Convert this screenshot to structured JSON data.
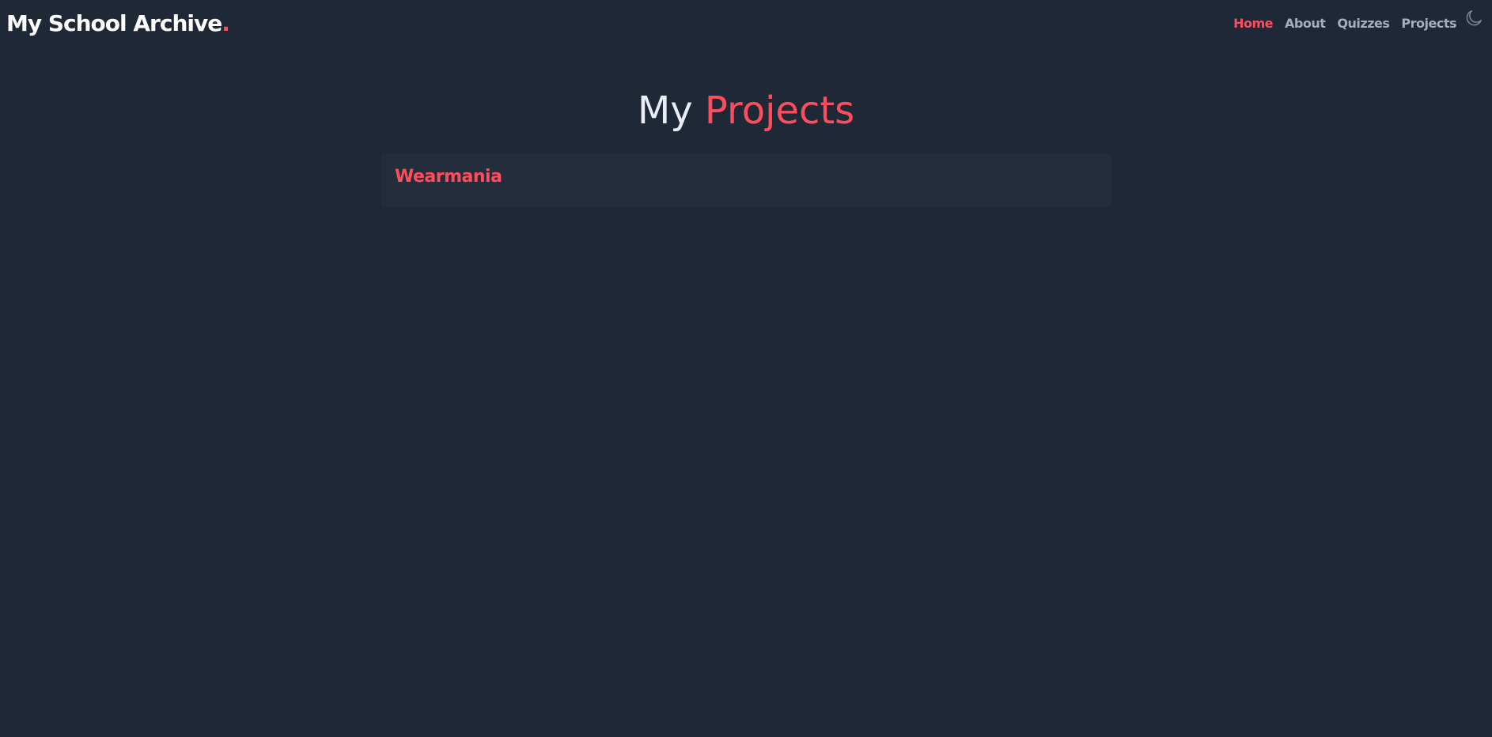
{
  "brand": {
    "name": "My School Archive",
    "dot": "."
  },
  "nav": {
    "items": [
      {
        "label": "Home",
        "active": true
      },
      {
        "label": "About",
        "active": false
      },
      {
        "label": "Quizzes",
        "active": false
      },
      {
        "label": "Projects",
        "active": false
      }
    ],
    "theme_toggle_icon": "moon-icon"
  },
  "page": {
    "heading_part1": "My",
    "heading_part2": "Projects"
  },
  "projects": [
    {
      "title": "Wearmania"
    }
  ],
  "colors": {
    "background": "#1f2837",
    "card_background": "#242d3c",
    "accent": "#ff4d5e",
    "nav_text": "#a6adb9",
    "heading_text": "#e9edf3"
  }
}
